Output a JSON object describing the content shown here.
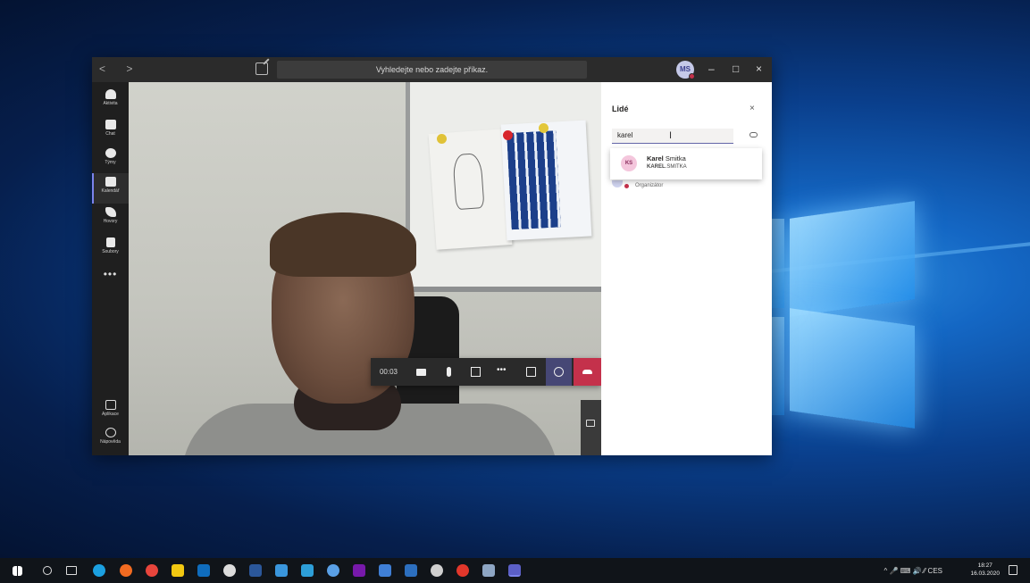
{
  "teams": {
    "search_placeholder": "Vyhledejte nebo zadejte příkaz.",
    "avatar_initials": "MS",
    "window_controls": {
      "minimize": "–",
      "maximize": "□",
      "close": "×"
    },
    "rail": [
      {
        "label": "Aktivita",
        "icon": "bell-icon"
      },
      {
        "label": "Chat",
        "icon": "chat-icon"
      },
      {
        "label": "Týmy",
        "icon": "teams-icon"
      },
      {
        "label": "Kalendář",
        "icon": "calendar-icon",
        "active": true
      },
      {
        "label": "Hovory",
        "icon": "phone-icon"
      },
      {
        "label": "Soubory",
        "icon": "file-icon"
      }
    ],
    "rail_more": "•••",
    "rail_bottom": [
      {
        "label": "Aplikace",
        "icon": "apps-icon"
      },
      {
        "label": "Nápověda",
        "icon": "help-icon"
      }
    ],
    "call": {
      "timer": "00:03",
      "more_label": "•••"
    },
    "people_panel": {
      "title": "Lidé",
      "close": "×",
      "input_value": "karel",
      "cursor": "I",
      "suggestion": {
        "initials": "KS",
        "name_bold": "Karel",
        "name_rest": " Smitka",
        "sub_bold": "KAREL",
        "sub_rest": ".SMITKA"
      },
      "organizer_label": "Organizátor"
    }
  },
  "taskbar": {
    "tray_text": "^ 🎤 ⌨ 🔊 ⁄⁄ CES",
    "time": "18:27",
    "date": "16.03.2020"
  },
  "colors": {
    "teams_accent": "#6264a7",
    "hangup": "#c4314b",
    "desktop": "#0a3f8c"
  }
}
